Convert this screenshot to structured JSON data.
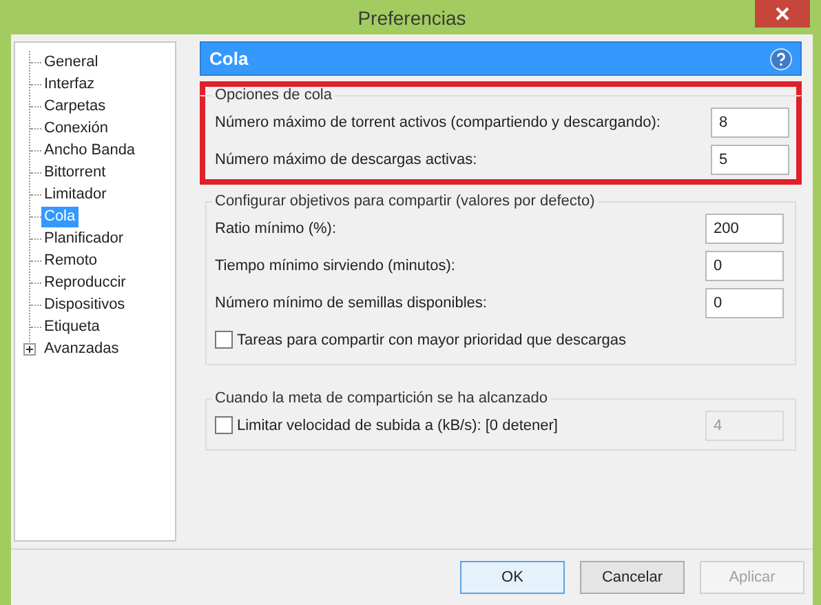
{
  "window": {
    "title": "Preferencias"
  },
  "sidebar": {
    "items": [
      {
        "label": "General",
        "kind": "leaf",
        "selected": false
      },
      {
        "label": "Interfaz",
        "kind": "leaf",
        "selected": false
      },
      {
        "label": "Carpetas",
        "kind": "leaf",
        "selected": false
      },
      {
        "label": "Conexión",
        "kind": "leaf",
        "selected": false
      },
      {
        "label": "Ancho Banda",
        "kind": "leaf",
        "selected": false
      },
      {
        "label": "Bittorrent",
        "kind": "leaf",
        "selected": false
      },
      {
        "label": "Limitador",
        "kind": "leaf",
        "selected": false
      },
      {
        "label": "Cola",
        "kind": "leaf",
        "selected": true
      },
      {
        "label": "Planificador",
        "kind": "leaf",
        "selected": false
      },
      {
        "label": "Remoto",
        "kind": "leaf",
        "selected": false
      },
      {
        "label": "Reproduccir",
        "kind": "leaf",
        "selected": false
      },
      {
        "label": "Dispositivos",
        "kind": "leaf",
        "selected": false
      },
      {
        "label": "Etiqueta",
        "kind": "leaf",
        "selected": false
      },
      {
        "label": "Avanzadas",
        "kind": "folder",
        "expanded": false,
        "selected": false
      }
    ]
  },
  "panel": {
    "title": "Cola",
    "groups": [
      {
        "title": "Opciones de cola",
        "highlighted": true,
        "rows": [
          {
            "kind": "number",
            "label": "Número máximo de torrent activos (compartiendo y descargando):",
            "value": "8"
          },
          {
            "kind": "number",
            "label": "Número máximo de descargas activas:",
            "value": "5"
          }
        ]
      },
      {
        "title": "Configurar objetivos para compartir (valores por defecto)",
        "highlighted": false,
        "rows": [
          {
            "kind": "number",
            "label": "Ratio mínimo (%):",
            "value": "200"
          },
          {
            "kind": "number",
            "label": "Tiempo mínimo sirviendo (minutos):",
            "value": "0"
          },
          {
            "kind": "number",
            "label": "Número mínimo de semillas disponibles:",
            "value": "0"
          },
          {
            "kind": "checkbox",
            "label": "Tareas para compartir con mayor prioridad que descargas",
            "checked": false
          }
        ]
      },
      {
        "title": "Cuando la meta de compartición se ha alcanzado",
        "highlighted": false,
        "rows": [
          {
            "kind": "checkbox_number",
            "label": "Limitar velocidad de subida a (kB/s): [0 detener]",
            "checked": false,
            "value": "4",
            "disabled": true
          }
        ]
      }
    ]
  },
  "buttons": [
    {
      "label": "OK",
      "default": true,
      "disabled": false
    },
    {
      "label": "Cancelar",
      "default": false,
      "disabled": false
    },
    {
      "label": "Aplicar",
      "default": false,
      "disabled": true
    }
  ]
}
